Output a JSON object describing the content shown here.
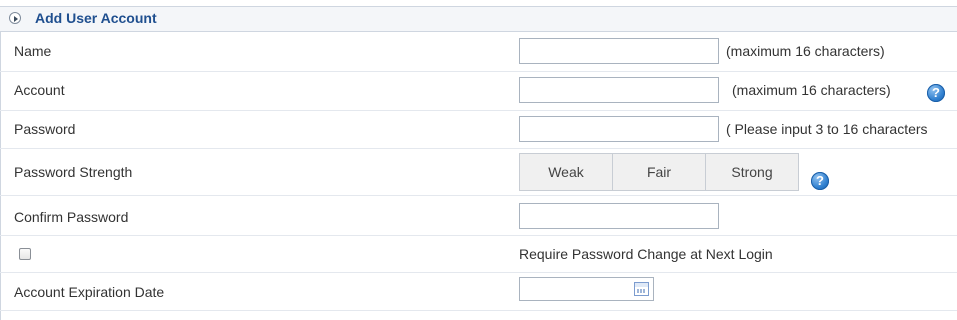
{
  "panel": {
    "title": "Add User Account"
  },
  "fields": {
    "name": {
      "label": "Name",
      "value": "",
      "hint": "(maximum 16 characters)"
    },
    "account": {
      "label": "Account",
      "value": "",
      "hint": "(maximum 16 characters)"
    },
    "password": {
      "label": "Password",
      "value": "",
      "hint": "( Please input 3 to 16 characters"
    },
    "password_strength": {
      "label": "Password Strength",
      "levels": [
        "Weak",
        "Fair",
        "Strong"
      ]
    },
    "confirm_password": {
      "label": "Confirm Password",
      "value": ""
    },
    "require_change": {
      "checked": false,
      "label": "Require Password Change at Next Login"
    },
    "expiration_date": {
      "label": "Account Expiration Date",
      "value": ""
    }
  },
  "icons": {
    "help": "help-icon",
    "calendar": "calendar-icon",
    "expand": "expand-arrow-icon"
  },
  "colors": {
    "title": "#1f4f8f",
    "help_icon": "#2f7fcf"
  }
}
